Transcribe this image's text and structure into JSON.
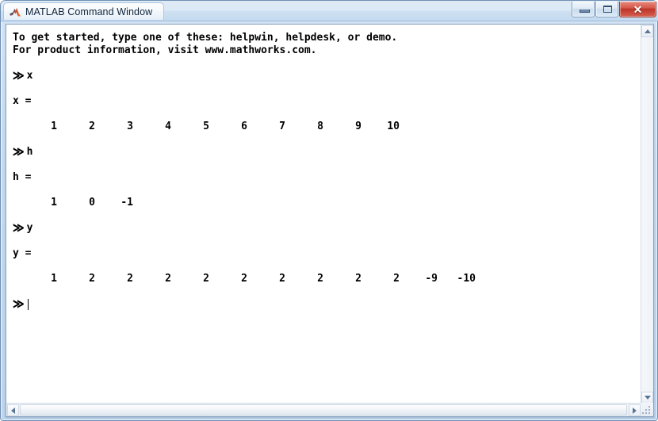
{
  "window": {
    "title": "MATLAB Command Window",
    "icon": "matlab-membrane-icon",
    "controls": {
      "minimize_label": "–",
      "maximize_label": "□",
      "close_label": "✕"
    },
    "accent_close": "#bd3527",
    "accent_titlebar": "#c9dcee"
  },
  "console": {
    "banner": [
      "To get started, type one of these: helpwin, helpdesk, or demo.",
      "For product information, visit www.mathworks.com."
    ],
    "prompt": "≫",
    "entries": [
      {
        "command": "x",
        "result_label": "x =",
        "values": [
          "1",
          "2",
          "3",
          "4",
          "5",
          "6",
          "7",
          "8",
          "9",
          "10"
        ]
      },
      {
        "command": "h",
        "result_label": "h =",
        "values": [
          "1",
          "0",
          "-1"
        ]
      },
      {
        "command": "y",
        "result_label": "y =",
        "values": [
          "1",
          "2",
          "2",
          "2",
          "2",
          "2",
          "2",
          "2",
          "2",
          "2",
          "-9",
          "-10"
        ]
      }
    ],
    "active_prompt": "≫",
    "cursor": "|"
  },
  "scrollbars": {
    "vertical": {
      "up_icon": "triangle-up-icon",
      "down_icon": "triangle-down-icon"
    },
    "horizontal": {
      "left_icon": "triangle-left-icon",
      "right_icon": "triangle-right-icon"
    },
    "resize_grip": "resize-grip-icon"
  }
}
